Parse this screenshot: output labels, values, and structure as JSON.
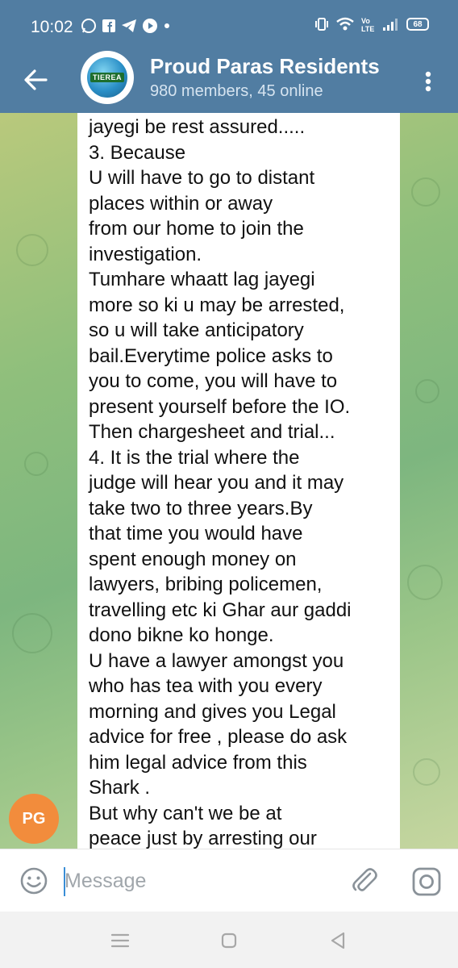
{
  "status_bar": {
    "time": "10:02",
    "notification_icons": [
      "whatsapp-icon",
      "facebook-icon",
      "telegram-icon",
      "youtube-icon",
      "dot-icon"
    ],
    "system_icons": [
      "vibrate-icon",
      "wifi-icon",
      "volte-icon",
      "signal-icon"
    ],
    "battery": "68"
  },
  "header": {
    "title": "Proud Paras Residents",
    "subtitle": "980 members, 45 online",
    "avatar_logo_text": "TIEREA",
    "colors": {
      "bar": "#517da2"
    }
  },
  "message": {
    "lines": [
      "jayegi be rest assured.....",
      "3.    Because",
      "U will have to go to distant",
      "places within or away",
      "from our home to join the",
      "investigation.",
      "Tumhare whaatt lag jayegi",
      "more so  ki u may be arrested,",
      "so u will take anticipatory",
      "bail.Everytime police asks to",
      "you to come, you will have to",
      "present yourself before the IO.",
      "Then chargesheet and trial...",
      "4.   It is the trial where the",
      "judge will hear you and it may",
      "take two to three years.By",
      "that time you would have",
      "spent enough money on",
      "lawyers, bribing policemen,",
      "travelling etc ki Ghar aur gaddi",
      "dono bikne ko honge.",
      "U have a lawyer amongst you",
      "who has tea with you every",
      "morning and gives you Legal",
      "advice for free , please do ask",
      "him legal advice from this",
      "Shark .",
      "But why can't we be at",
      "peace just by arresting our"
    ]
  },
  "sender": {
    "initials": "PG",
    "color": "#f28c3c"
  },
  "composer": {
    "placeholder": "Message",
    "value": ""
  },
  "nav": {
    "buttons": [
      "menu-icon",
      "home-icon",
      "back-triangle-icon"
    ]
  }
}
